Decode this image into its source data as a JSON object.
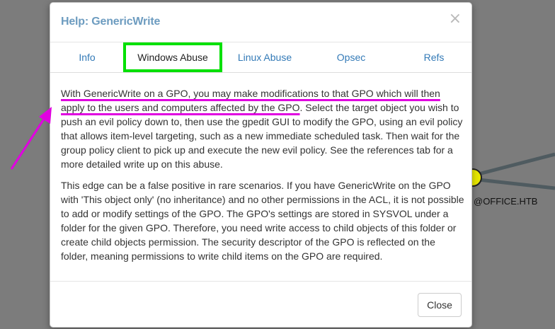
{
  "background": {
    "node_label": "@OFFICE.HTB"
  },
  "modal": {
    "title": "Help: GenericWrite",
    "close_icon": "×",
    "tabs": [
      {
        "label": "Info"
      },
      {
        "label": "Windows Abuse",
        "active": true
      },
      {
        "label": "Linux Abuse"
      },
      {
        "label": "Opsec"
      },
      {
        "label": "Refs"
      }
    ],
    "body": {
      "p1_highlight_1": "With GenericWrite on a GPO, you may make modifications to that GPO which will then",
      "p1_highlight_2": "apply to the users and computers affected by the GPO",
      "p1_rest": ". Select the target object you wish to push an evil policy down to, then use the gpedit GUI to modify the GPO, using an evil policy that allows item-level targeting, such as a new immediate scheduled task. Then wait for the group policy client to pick up and execute the new evil policy. See the references tab for a more detailed write up on this abuse.",
      "p2": "This edge can be a false positive in rare scenarios. If you have GenericWrite on the GPO with 'This object only' (no inheritance) and no other permissions in the ACL, it is not possible to add or modify settings of the GPO. The GPO's settings are stored in SYSVOL under a folder for the given GPO. Therefore, you need write access to child objects of this folder or create child objects permission. The security descriptor of the GPO is reflected on the folder, meaning permissions to write child items on the GPO are required."
    },
    "footer": {
      "close_label": "Close"
    }
  },
  "colors": {
    "annotation": "#e000e0",
    "active_tab_box": "#00e000",
    "title": "#6d9cc0",
    "link": "#337ab7"
  }
}
